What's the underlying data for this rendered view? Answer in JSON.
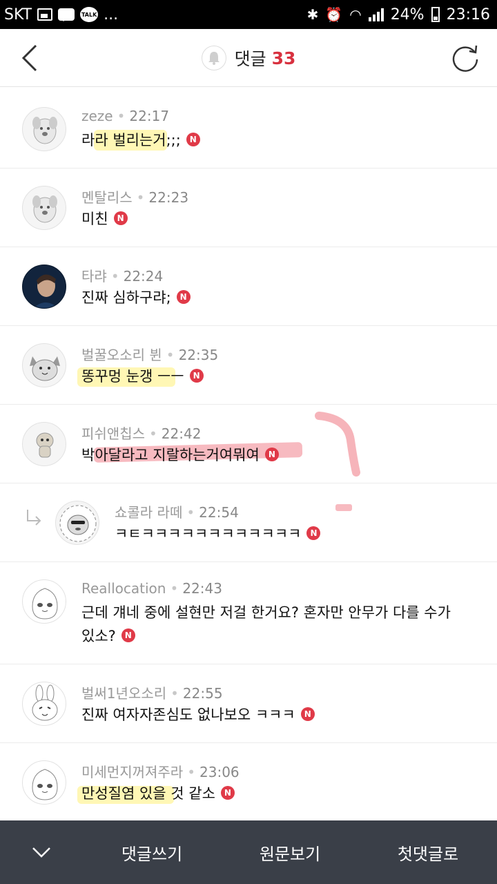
{
  "status_bar": {
    "carrier": "SKT",
    "talk_label": "TALK",
    "more": "...",
    "battery": "24%",
    "time": "23:16"
  },
  "header": {
    "title": "댓글",
    "count": "33"
  },
  "comments": [
    {
      "name": "zeze",
      "time": "22:17",
      "text": "라라 벌리는거;;;",
      "new_label": "N",
      "avatar": "dog-character-avatar"
    },
    {
      "name": "멘탈리스",
      "time": "22:23",
      "text": "미친",
      "new_label": "N",
      "avatar": "dog-character-avatar"
    },
    {
      "name": "타랴",
      "time": "22:24",
      "text": "진짜 심하구랴;",
      "new_label": "N",
      "avatar": "photo-avatar"
    },
    {
      "name": "벌꿀오소리 뷘",
      "time": "22:35",
      "text": "똥꾸멍 눈갱 ㅡㅡ",
      "new_label": "N",
      "avatar": "cat-character-avatar"
    },
    {
      "name": "피쉬앤칩스",
      "time": "22:42",
      "text": "박아달라고 지랄하는거여뭐여",
      "new_label": "N",
      "avatar": "creature-character-avatar"
    },
    {
      "name": "쇼콜라 라떼",
      "time": "22:54",
      "text": "ㅋㅌㅋㅋㅋㅋㅋㅋㅋㅋㅋㅋㅋㅋ",
      "new_label": "N",
      "avatar": "lion-character-avatar",
      "reply": true
    },
    {
      "name": "Reallocation",
      "time": "22:43",
      "text": "근데 걔네 중에 설현만 저걸 한거요? 혼자만 안무가 다를 수가 있소?",
      "new_label": "N",
      "avatar": "peach-character-avatar"
    },
    {
      "name": "벌써1년오소리",
      "time": "22:55",
      "text": "진짜 여자자존심도 없나보오 ㅋㅋㅋ",
      "new_label": "N",
      "avatar": "rabbit-character-avatar"
    },
    {
      "name": "미세먼지꺼져주라",
      "time": "23:06",
      "text": "만성질염 있을 것 같소",
      "new_label": "N",
      "avatar": "peach-character-avatar"
    }
  ],
  "bottom_bar": {
    "write_comment": "댓글쓰기",
    "view_original": "원문보기",
    "first_comment": "첫댓글로"
  },
  "colors": {
    "accent": "#d8313f",
    "new_badge": "#e03a48",
    "bottom_bar": "#3a3f48"
  }
}
